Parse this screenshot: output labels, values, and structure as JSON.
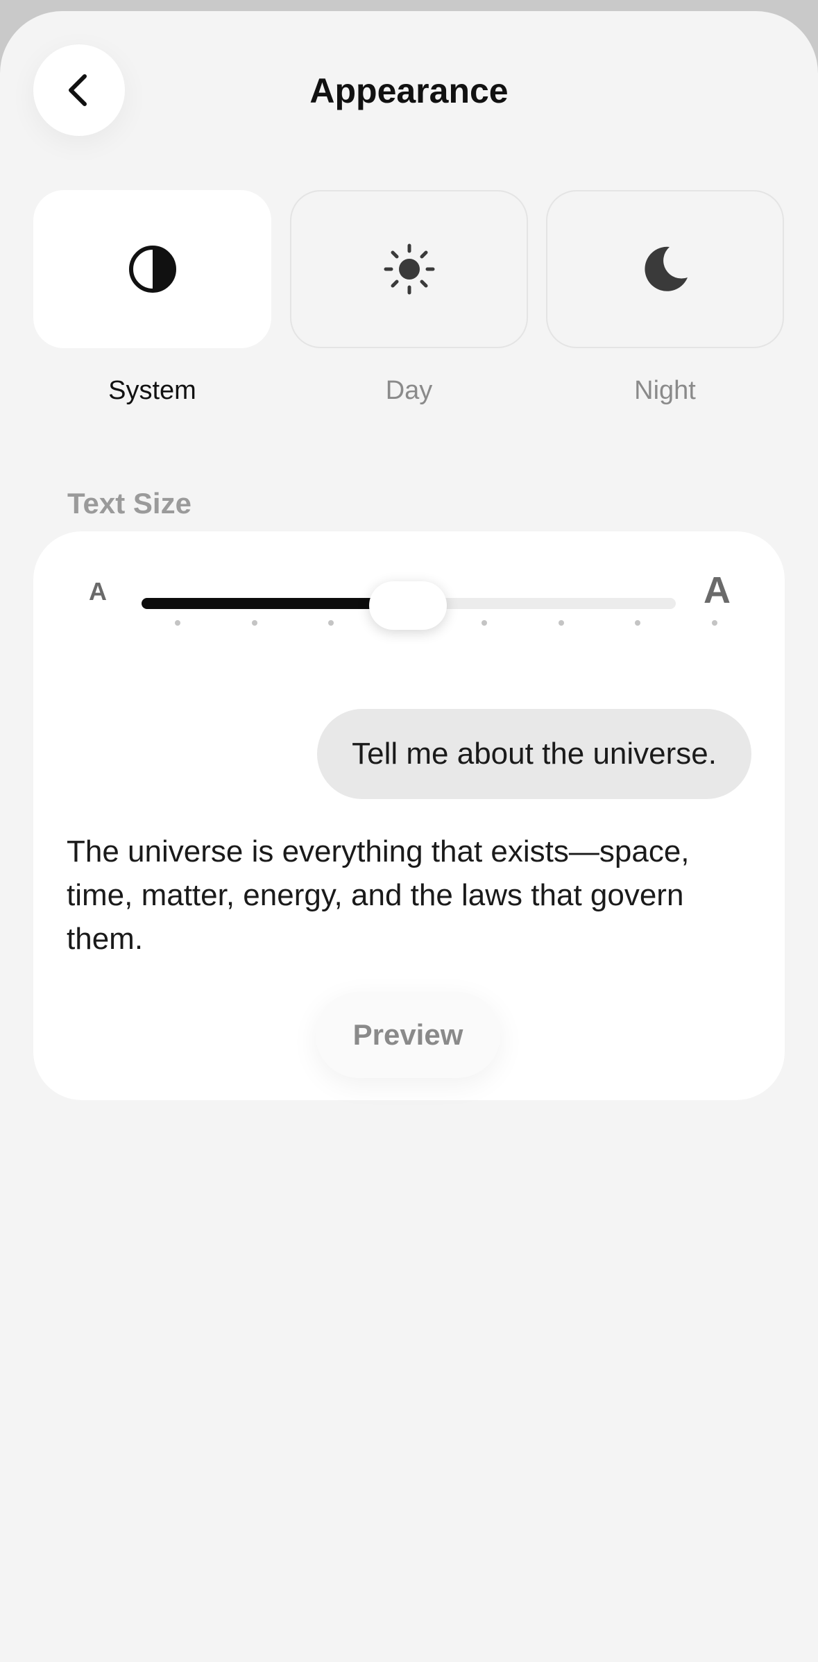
{
  "header": {
    "title": "Appearance",
    "back_icon": "chevron-left-icon"
  },
  "theme_modes": [
    {
      "label": "System",
      "icon": "half-circle-icon",
      "selected": true
    },
    {
      "label": "Day",
      "icon": "sun-icon",
      "selected": false
    },
    {
      "label": "Night",
      "icon": "moon-icon",
      "selected": false
    }
  ],
  "text_size": {
    "section_label": "Text Size",
    "small_label": "A",
    "large_label": "A",
    "slider": {
      "steps": 8,
      "selected_step": 3
    },
    "preview": {
      "user_message": "Tell me about the universe.",
      "assistant_message": "The universe is everything that exists—space, time, matter, energy, and the laws that govern them.",
      "button_label": "Preview"
    }
  },
  "colors": {
    "background": "#f4f4f4",
    "card": "#ffffff",
    "text_primary": "#111111",
    "text_secondary": "#8a8a8a",
    "slider_fill": "#0d0d0d"
  }
}
